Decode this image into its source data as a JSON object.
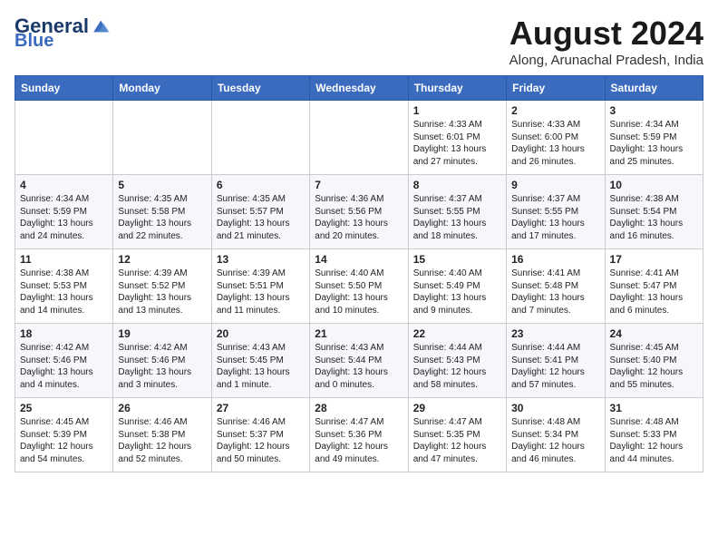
{
  "header": {
    "logo_general": "General",
    "logo_blue": "Blue",
    "month_year": "August 2024",
    "location": "Along, Arunachal Pradesh, India"
  },
  "weekdays": [
    "Sunday",
    "Monday",
    "Tuesday",
    "Wednesday",
    "Thursday",
    "Friday",
    "Saturday"
  ],
  "weeks": [
    [
      {
        "day": "",
        "content": ""
      },
      {
        "day": "",
        "content": ""
      },
      {
        "day": "",
        "content": ""
      },
      {
        "day": "",
        "content": ""
      },
      {
        "day": "1",
        "content": "Sunrise: 4:33 AM\nSunset: 6:01 PM\nDaylight: 13 hours and 27 minutes."
      },
      {
        "day": "2",
        "content": "Sunrise: 4:33 AM\nSunset: 6:00 PM\nDaylight: 13 hours and 26 minutes."
      },
      {
        "day": "3",
        "content": "Sunrise: 4:34 AM\nSunset: 5:59 PM\nDaylight: 13 hours and 25 minutes."
      }
    ],
    [
      {
        "day": "4",
        "content": "Sunrise: 4:34 AM\nSunset: 5:59 PM\nDaylight: 13 hours and 24 minutes."
      },
      {
        "day": "5",
        "content": "Sunrise: 4:35 AM\nSunset: 5:58 PM\nDaylight: 13 hours and 22 minutes."
      },
      {
        "day": "6",
        "content": "Sunrise: 4:35 AM\nSunset: 5:57 PM\nDaylight: 13 hours and 21 minutes."
      },
      {
        "day": "7",
        "content": "Sunrise: 4:36 AM\nSunset: 5:56 PM\nDaylight: 13 hours and 20 minutes."
      },
      {
        "day": "8",
        "content": "Sunrise: 4:37 AM\nSunset: 5:55 PM\nDaylight: 13 hours and 18 minutes."
      },
      {
        "day": "9",
        "content": "Sunrise: 4:37 AM\nSunset: 5:55 PM\nDaylight: 13 hours and 17 minutes."
      },
      {
        "day": "10",
        "content": "Sunrise: 4:38 AM\nSunset: 5:54 PM\nDaylight: 13 hours and 16 minutes."
      }
    ],
    [
      {
        "day": "11",
        "content": "Sunrise: 4:38 AM\nSunset: 5:53 PM\nDaylight: 13 hours and 14 minutes."
      },
      {
        "day": "12",
        "content": "Sunrise: 4:39 AM\nSunset: 5:52 PM\nDaylight: 13 hours and 13 minutes."
      },
      {
        "day": "13",
        "content": "Sunrise: 4:39 AM\nSunset: 5:51 PM\nDaylight: 13 hours and 11 minutes."
      },
      {
        "day": "14",
        "content": "Sunrise: 4:40 AM\nSunset: 5:50 PM\nDaylight: 13 hours and 10 minutes."
      },
      {
        "day": "15",
        "content": "Sunrise: 4:40 AM\nSunset: 5:49 PM\nDaylight: 13 hours and 9 minutes."
      },
      {
        "day": "16",
        "content": "Sunrise: 4:41 AM\nSunset: 5:48 PM\nDaylight: 13 hours and 7 minutes."
      },
      {
        "day": "17",
        "content": "Sunrise: 4:41 AM\nSunset: 5:47 PM\nDaylight: 13 hours and 6 minutes."
      }
    ],
    [
      {
        "day": "18",
        "content": "Sunrise: 4:42 AM\nSunset: 5:46 PM\nDaylight: 13 hours and 4 minutes."
      },
      {
        "day": "19",
        "content": "Sunrise: 4:42 AM\nSunset: 5:46 PM\nDaylight: 13 hours and 3 minutes."
      },
      {
        "day": "20",
        "content": "Sunrise: 4:43 AM\nSunset: 5:45 PM\nDaylight: 13 hours and 1 minute."
      },
      {
        "day": "21",
        "content": "Sunrise: 4:43 AM\nSunset: 5:44 PM\nDaylight: 13 hours and 0 minutes."
      },
      {
        "day": "22",
        "content": "Sunrise: 4:44 AM\nSunset: 5:43 PM\nDaylight: 12 hours and 58 minutes."
      },
      {
        "day": "23",
        "content": "Sunrise: 4:44 AM\nSunset: 5:41 PM\nDaylight: 12 hours and 57 minutes."
      },
      {
        "day": "24",
        "content": "Sunrise: 4:45 AM\nSunset: 5:40 PM\nDaylight: 12 hours and 55 minutes."
      }
    ],
    [
      {
        "day": "25",
        "content": "Sunrise: 4:45 AM\nSunset: 5:39 PM\nDaylight: 12 hours and 54 minutes."
      },
      {
        "day": "26",
        "content": "Sunrise: 4:46 AM\nSunset: 5:38 PM\nDaylight: 12 hours and 52 minutes."
      },
      {
        "day": "27",
        "content": "Sunrise: 4:46 AM\nSunset: 5:37 PM\nDaylight: 12 hours and 50 minutes."
      },
      {
        "day": "28",
        "content": "Sunrise: 4:47 AM\nSunset: 5:36 PM\nDaylight: 12 hours and 49 minutes."
      },
      {
        "day": "29",
        "content": "Sunrise: 4:47 AM\nSunset: 5:35 PM\nDaylight: 12 hours and 47 minutes."
      },
      {
        "day": "30",
        "content": "Sunrise: 4:48 AM\nSunset: 5:34 PM\nDaylight: 12 hours and 46 minutes."
      },
      {
        "day": "31",
        "content": "Sunrise: 4:48 AM\nSunset: 5:33 PM\nDaylight: 12 hours and 44 minutes."
      }
    ]
  ]
}
